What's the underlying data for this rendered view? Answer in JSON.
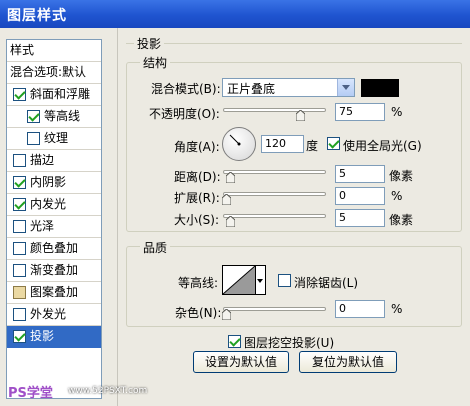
{
  "window": {
    "title": "图层样式"
  },
  "left_panel": {
    "items": [
      {
        "label": "样式",
        "checkbox": "none",
        "selected": false
      },
      {
        "label": "混合选项:默认",
        "checkbox": "none",
        "selected": false
      },
      {
        "label": "斜面和浮雕",
        "checkbox": "checked",
        "selected": false
      },
      {
        "label": "等高线",
        "checkbox": "checked",
        "selected": false,
        "indent": true
      },
      {
        "label": "纹理",
        "checkbox": "unchecked",
        "selected": false,
        "indent": true
      },
      {
        "label": "描边",
        "checkbox": "unchecked",
        "selected": false
      },
      {
        "label": "内阴影",
        "checkbox": "checked",
        "selected": false
      },
      {
        "label": "内发光",
        "checkbox": "checked",
        "selected": false
      },
      {
        "label": "光泽",
        "checkbox": "unchecked",
        "selected": false
      },
      {
        "label": "颜色叠加",
        "checkbox": "unchecked",
        "selected": false
      },
      {
        "label": "渐变叠加",
        "checkbox": "unchecked",
        "selected": false
      },
      {
        "label": "图案叠加",
        "checkbox": "square",
        "selected": false
      },
      {
        "label": "外发光",
        "checkbox": "unchecked",
        "selected": false
      },
      {
        "label": "投影",
        "checkbox": "checked",
        "selected": true
      }
    ]
  },
  "panel": {
    "section_title": "投影",
    "structure": {
      "title": "结构",
      "blend_mode_label": "混合模式(B):",
      "blend_mode_value": "正片叠底",
      "blend_color": "#000000",
      "opacity_label": "不透明度(O):",
      "opacity_value": "75",
      "opacity_unit": "%",
      "opacity_level": 0.75,
      "angle_label": "角度(A):",
      "angle_value": "120",
      "angle_unit": "度",
      "global_light_label": "使用全局光(G)",
      "global_light_checked": true,
      "distance_label": "距离(D):",
      "distance_value": "5",
      "distance_unit": "像素",
      "spread_label": "扩展(R):",
      "spread_value": "0",
      "spread_unit": "%",
      "size_label": "大小(S):",
      "size_value": "5",
      "size_unit": "像素"
    },
    "quality": {
      "title": "品质",
      "contour_label": "等高线:",
      "antialias_label": "消除锯齿(L)",
      "antialias_checked": false,
      "noise_label": "杂色(N):",
      "noise_value": "0",
      "noise_unit": "%"
    },
    "knockout_label": "图层挖空投影(U)",
    "knockout_checked": true,
    "set_default_button": "设置为默认值",
    "reset_default_button": "复位为默认值"
  },
  "watermark": {
    "left": "PS学堂",
    "right": "www.52PSXT.com"
  }
}
